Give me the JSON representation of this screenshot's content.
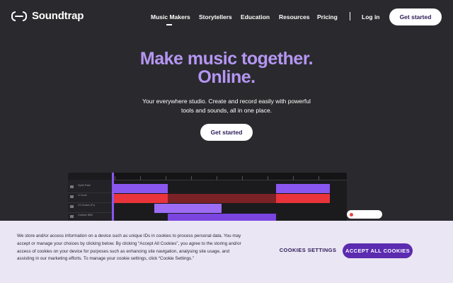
{
  "brand": {
    "name": "Soundtrap"
  },
  "nav": {
    "items": [
      {
        "label": "Music Makers",
        "active": true
      },
      {
        "label": "Storytellers"
      },
      {
        "label": "Education"
      },
      {
        "label": "Resources"
      },
      {
        "label": "Pricing"
      }
    ],
    "login": "Log in",
    "cta": "Get started"
  },
  "hero": {
    "title_line1": "Make music together.",
    "title_line2": "Online.",
    "subtitle_line1": "Your everywhere studio. Create and record easily with powerful",
    "subtitle_line2": "tools and sounds, all in one place.",
    "cta": "Get started"
  },
  "daw": {
    "tracks": [
      {
        "label": "Synth Pads"
      },
      {
        "label": "Lf Vocal"
      },
      {
        "label": "VS Guitars (Fx)"
      },
      {
        "label": "Grabber BBB"
      }
    ]
  },
  "cookie": {
    "text": "We store and/or access information on a device such as unique IDs in cookies to process personal data. You may accept or manage your choices by clicking below. By clicking “Accept All Cookies”, you agree to the storing and/or access of cookies on your device for purposes such as enhancing site navigation, analysing site usage, and assisting in our marketing efforts. To manage your cookie settings, click “Cookie Settings.”",
    "settings_label": "COOKIES SETTINGS",
    "accept_label": "ACCEPT ALL COOKIES"
  },
  "colors": {
    "background": "#2a2a2e",
    "accent": "#b596f2",
    "button_primary": "#5b2bb0",
    "clip_purple": "#8a56f0",
    "clip_red": "#e8343a"
  }
}
